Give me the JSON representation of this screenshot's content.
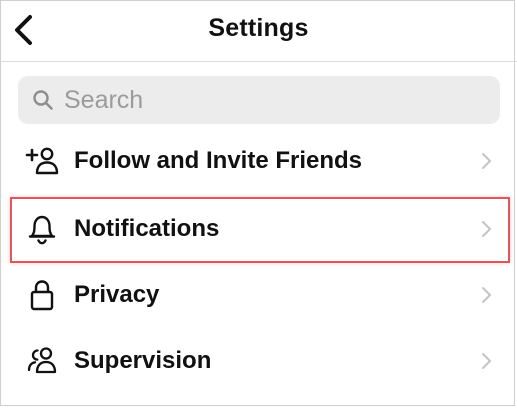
{
  "header": {
    "title": "Settings"
  },
  "search": {
    "placeholder": "Search",
    "value": ""
  },
  "menu": [
    {
      "label": "Follow and Invite Friends",
      "icon": "add-person-icon"
    },
    {
      "label": "Notifications",
      "icon": "bell-icon",
      "highlighted": true
    },
    {
      "label": "Privacy",
      "icon": "lock-icon"
    },
    {
      "label": "Supervision",
      "icon": "people-icon"
    }
  ],
  "colors": {
    "highlight_border": "#e0565b",
    "search_bg": "#ececec",
    "chevron": "#c4c4c8",
    "placeholder": "#9b9b9b"
  }
}
